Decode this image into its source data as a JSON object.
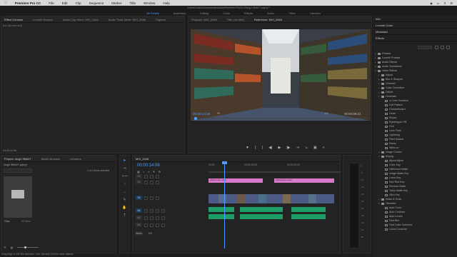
{
  "menubar": {
    "app": "Premiere Pro CC",
    "items": [
      "File",
      "Edit",
      "Clip",
      "Sequence",
      "Marker",
      "Title",
      "Window",
      "Help"
    ]
  },
  "workspace": {
    "path": "/Users/Justin/Documents/Adobe/Premiere Pro/11.0/vlog1 9feb27.prproj *",
    "tabs": [
      "All Panels",
      "Assembly",
      "Editing",
      "Color",
      "Effects",
      "Audio",
      "Titles",
      "Libraries"
    ],
    "active_tab": "All Panels"
  },
  "effect_controls": {
    "tabs": [
      "Effect Controls",
      "Lumetri Scopes",
      "Audio Clip Mixer: MVI_2446",
      "Audio Track Mixer: MVI_2446",
      "Capture"
    ],
    "active_tab": "Effect Controls",
    "empty_text": "(no clip selected)",
    "timecode": "00:00:14:06"
  },
  "program_monitor": {
    "tabs": [
      "Program: MVI_2446",
      "Title: (no title)",
      "Reference: MVI_2446"
    ],
    "active_tab": "Reference: MVI_2446",
    "timecode_current": "00:00:14:06",
    "fit": "Fit",
    "quality": "1/4",
    "timecode_duration": "00:00:09:22"
  },
  "right_panel": {
    "sections": [
      "Info",
      "Lumetri Color",
      "Metadata"
    ],
    "effects_title": "Effects",
    "effects_tree": [
      {
        "label": "Presets",
        "kind": "folder",
        "indent": 0
      },
      {
        "label": "Lumetri Presets",
        "kind": "folder",
        "indent": 0
      },
      {
        "label": "Audio Effects",
        "kind": "folder",
        "indent": 0
      },
      {
        "label": "Audio Transitions",
        "kind": "folder",
        "indent": 0
      },
      {
        "label": "Video Effects",
        "kind": "folder",
        "indent": 0,
        "open": true
      },
      {
        "label": "Adjust",
        "kind": "folder",
        "indent": 1
      },
      {
        "label": "Blur & Sharpen",
        "kind": "folder",
        "indent": 1
      },
      {
        "label": "Channel",
        "kind": "folder",
        "indent": 1
      },
      {
        "label": "Color Correction",
        "kind": "folder",
        "indent": 1
      },
      {
        "label": "Distort",
        "kind": "folder",
        "indent": 1
      },
      {
        "label": "Generate",
        "kind": "folder",
        "indent": 1,
        "open": true
      },
      {
        "label": "4-Color Gradient",
        "kind": "item",
        "indent": 2
      },
      {
        "label": "Cell Pattern",
        "kind": "item",
        "indent": 2
      },
      {
        "label": "Checkerboard",
        "kind": "item",
        "indent": 2
      },
      {
        "label": "Circle",
        "kind": "item",
        "indent": 2
      },
      {
        "label": "Ellipse",
        "kind": "item",
        "indent": 2
      },
      {
        "label": "Eyedropper Fill",
        "kind": "item",
        "indent": 2
      },
      {
        "label": "Grid",
        "kind": "item",
        "indent": 2
      },
      {
        "label": "Lens Flare",
        "kind": "item",
        "indent": 2
      },
      {
        "label": "Lightning",
        "kind": "item",
        "indent": 2
      },
      {
        "label": "Paint Bucket",
        "kind": "item",
        "indent": 2
      },
      {
        "label": "Ramp",
        "kind": "item",
        "indent": 2
      },
      {
        "label": "Write-on",
        "kind": "item",
        "indent": 2
      },
      {
        "label": "Image Control",
        "kind": "folder",
        "indent": 1
      },
      {
        "label": "Keying",
        "kind": "folder",
        "indent": 1,
        "open": true
      },
      {
        "label": "Alpha Adjust",
        "kind": "item",
        "indent": 2
      },
      {
        "label": "Color Key",
        "kind": "item",
        "indent": 2
      },
      {
        "label": "Difference Matte",
        "kind": "item",
        "indent": 2
      },
      {
        "label": "Image Matte Key",
        "kind": "item",
        "indent": 2
      },
      {
        "label": "Luma Key",
        "kind": "item",
        "indent": 2
      },
      {
        "label": "Non Red Key",
        "kind": "item",
        "indent": 2
      },
      {
        "label": "Remove Matte",
        "kind": "item",
        "indent": 2
      },
      {
        "label": "Track Matte Key",
        "kind": "item",
        "indent": 2
      },
      {
        "label": "Ultra Key",
        "kind": "item",
        "indent": 2
      },
      {
        "label": "Noise & Grain",
        "kind": "folder",
        "indent": 1
      },
      {
        "label": "Obsolete",
        "kind": "folder",
        "indent": 1,
        "open": true
      },
      {
        "label": "Auto Color",
        "kind": "item",
        "indent": 2
      },
      {
        "label": "Auto Contrast",
        "kind": "item",
        "indent": 2
      },
      {
        "label": "Auto Levels",
        "kind": "item",
        "indent": 2
      },
      {
        "label": "Fast Blur",
        "kind": "item",
        "indent": 2
      },
      {
        "label": "Fast Color Corrector",
        "kind": "item",
        "indent": 2
      },
      {
        "label": "Luma Corrector",
        "kind": "item",
        "indent": 2
      }
    ]
  },
  "project_panel": {
    "tabs": [
      "Project: vlog1 9feb27",
      "Media Browser",
      "Libraries"
    ],
    "active_tab": "Project: vlog1 9feb27",
    "file": "vlog1 9feb27.prproj",
    "selection_count": "1 of 1 items selected",
    "bin_name": "Clips",
    "bin_items": "50 Items"
  },
  "timeline": {
    "sequence_tab": "MVI_2446",
    "timecode": "00:00:14:06",
    "ruler_labels": [
      "00:00",
      "00:00:15:00",
      "00:00:30:00"
    ],
    "tracks": [
      {
        "id": "V3",
        "kind": "video"
      },
      {
        "id": "V2",
        "kind": "video"
      },
      {
        "id": "V1",
        "kind": "video",
        "target": true
      },
      {
        "id": "A1",
        "kind": "audio",
        "target": true
      },
      {
        "id": "A2",
        "kind": "audio"
      },
      {
        "id": "A3",
        "kind": "audio"
      },
      {
        "id": "Master",
        "kind": "master",
        "volume": "0.0"
      }
    ],
    "clips": {
      "adjustment_label": "Adjustment Layer"
    }
  },
  "meter": {
    "scale": [
      "0",
      "-6",
      "-12",
      "-18",
      "-24",
      "-30",
      "-36",
      "-42",
      "-48",
      "-54",
      "dB"
    ]
  },
  "status_text": "Drag edge to trim the selection. Use Opt and Cmd for other options.",
  "colors": {
    "accent": "#4a9bff",
    "adjustment_clip": "#d879c9",
    "video_clip": "#4b5b86",
    "audio_clip": "#1f9d66"
  }
}
